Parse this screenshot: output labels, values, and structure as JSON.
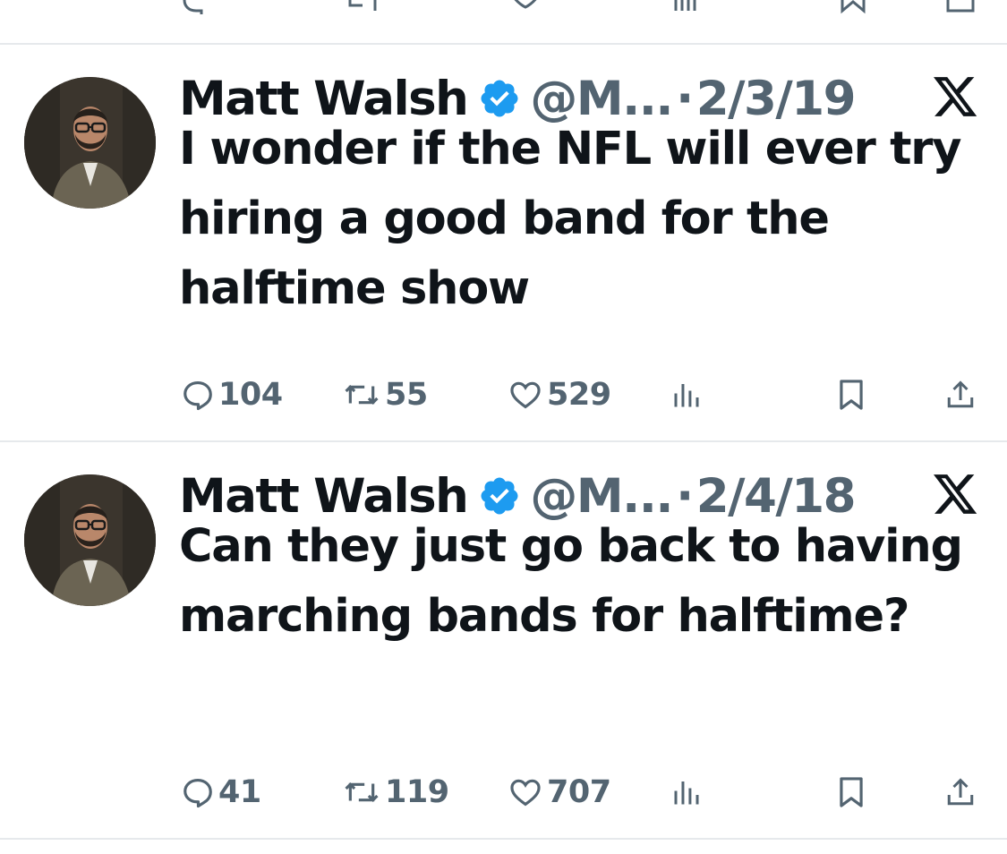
{
  "tweets": [
    {
      "author": "Matt Walsh",
      "handle": "@M...",
      "separator": "·",
      "date": "2/3/19",
      "text": "I wonder if the NFL will ever try hiring a good band for the halftime show",
      "replies": "104",
      "retweets": "55",
      "likes": "529"
    },
    {
      "author": "Matt Walsh",
      "handle": "@M...",
      "separator": "·",
      "date": "2/4/18",
      "text": "Can they just go back to having marching bands for halftime?",
      "replies": "41",
      "retweets": "119",
      "likes": "707"
    }
  ],
  "icons": {
    "reply": "reply-icon",
    "retweet": "retweet-icon",
    "like": "heart-icon",
    "views": "views-icon",
    "bookmark": "bookmark-icon",
    "share": "share-icon",
    "verified": "verified-badge-icon",
    "platform": "x-logo-icon"
  },
  "colors": {
    "text": "#0f1419",
    "secondary": "#536471",
    "verified": "#1d9bf0",
    "divider": "#e6e9ec"
  }
}
